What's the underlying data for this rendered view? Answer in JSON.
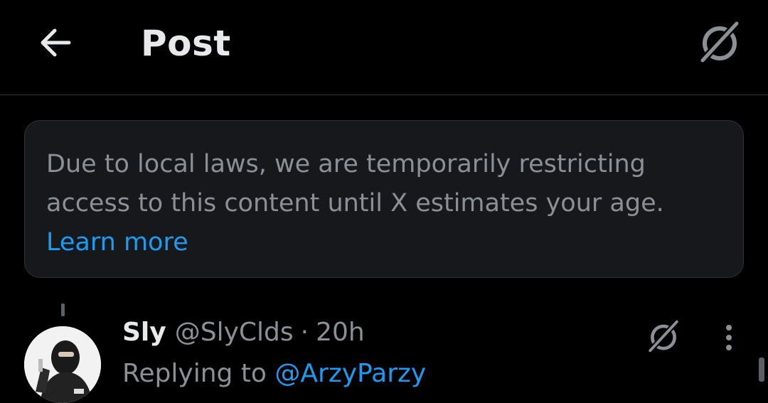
{
  "header": {
    "title": "Post",
    "back_icon": "arrow-left-icon",
    "grok_icon": "grok-icon"
  },
  "notice": {
    "message": "Due to local laws, we are temporarily restricting access to this content until X estimates your age.",
    "link_label": "Learn more"
  },
  "post": {
    "author_name": "Sly",
    "author_handle": "@SlyClds",
    "separator": "·",
    "time": "20h",
    "replying_prefix": "Replying to",
    "replying_handle": "@ArzyParzy",
    "grok_icon": "grok-icon",
    "more_icon": "more-vertical-icon"
  },
  "colors": {
    "background": "#000000",
    "notice_background": "#16181c",
    "border": "#2f3336",
    "primary_text": "#e7e9ea",
    "secondary_text": "#8b9095",
    "accent": "#1d9bf0"
  }
}
